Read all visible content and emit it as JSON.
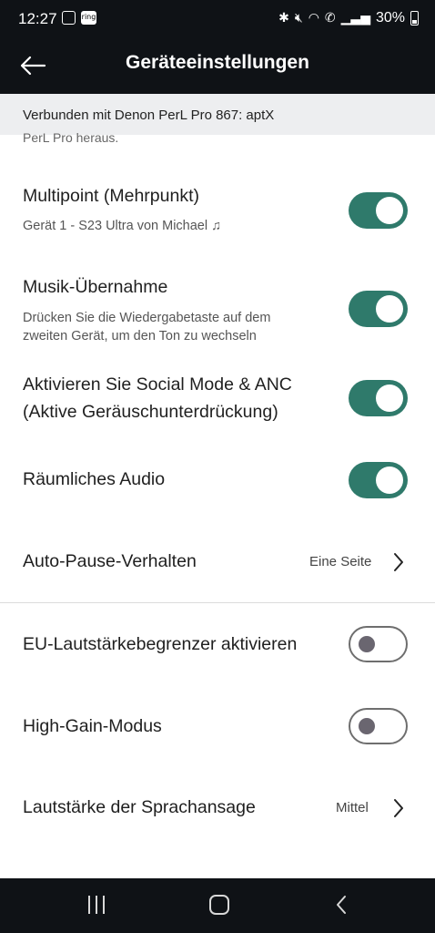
{
  "status_bar": {
    "time": "12:27",
    "ring_label": "ring",
    "battery": "30%",
    "icons": [
      "gallery-icon",
      "ring-icon",
      "bluetooth-icon",
      "mute-icon",
      "wifi-icon",
      "call-icon",
      "signal-icon",
      "battery-icon"
    ]
  },
  "app_bar": {
    "title": "Geräteeinstellungen"
  },
  "banner": {
    "text": "Verbunden mit Denon PerL Pro 867: aptX"
  },
  "partial_text": "PerL Pro heraus.",
  "settings": {
    "multipoint": {
      "title": "Multipoint (Mehrpunkt)",
      "subtitle": "Gerät 1 - S23 Ultra von Michael ♫",
      "enabled": true
    },
    "music_takeover": {
      "title": "Musik-Übernahme",
      "subtitle_line1": "Drücken Sie die Wiedergabetaste auf dem",
      "subtitle_line2": "zweiten Gerät, um den Ton zu wechseln",
      "enabled": true
    },
    "social_mode": {
      "title_line1": "Aktivieren Sie Social Mode & ANC",
      "title_line2": "(Aktive Geräuschunterdrückung)",
      "enabled": true
    },
    "spatial_audio": {
      "title": "Räumliches Audio",
      "enabled": true
    },
    "auto_pause": {
      "title": "Auto-Pause-Verhalten",
      "value": "Eine Seite"
    },
    "eu_limiter": {
      "title": "EU-Lautstärkebegrenzer aktivieren",
      "enabled": false
    },
    "high_gain": {
      "title": "High-Gain-Modus",
      "enabled": false
    },
    "voice_prompt_volume": {
      "title": "Lautstärke der Sprachansage",
      "value": "Mittel"
    }
  },
  "colors": {
    "toggle_on": "#2f7a6b",
    "header_bg": "#0f1216",
    "banner_bg": "#edeef0"
  }
}
